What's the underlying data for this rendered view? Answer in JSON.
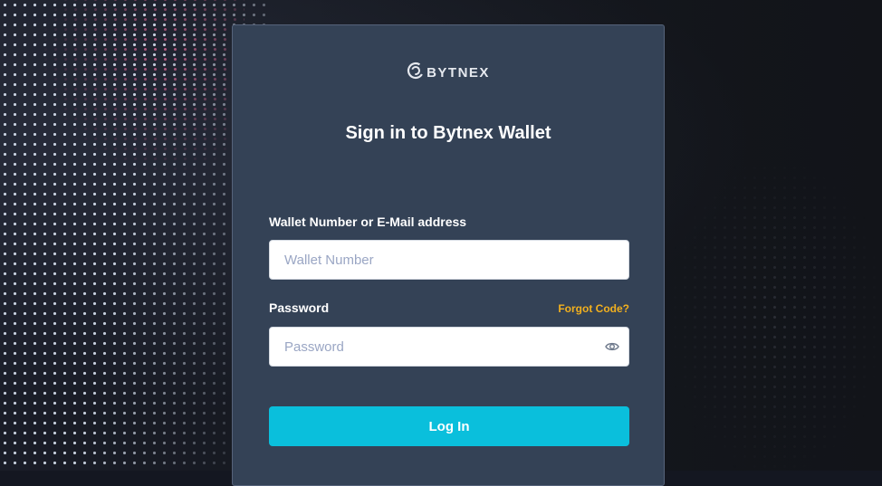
{
  "brand": {
    "logo_text": "BYTNEX",
    "logo_icon": "bytnex-swirl-icon"
  },
  "page": {
    "title": "Sign in to Bytnex Wallet"
  },
  "form": {
    "wallet": {
      "label": "Wallet Number or E-Mail address",
      "placeholder": "Wallet Number",
      "value": ""
    },
    "password": {
      "label": "Password",
      "placeholder": "Password",
      "value": "",
      "toggle_icon": "eye-icon"
    },
    "forgot_label": "Forgot Code?",
    "submit_label": "Log In"
  },
  "colors": {
    "card_bg": "#344256",
    "accent_button": "#0abfdc",
    "link": "#f2b01e",
    "page_bg": "#141721"
  }
}
